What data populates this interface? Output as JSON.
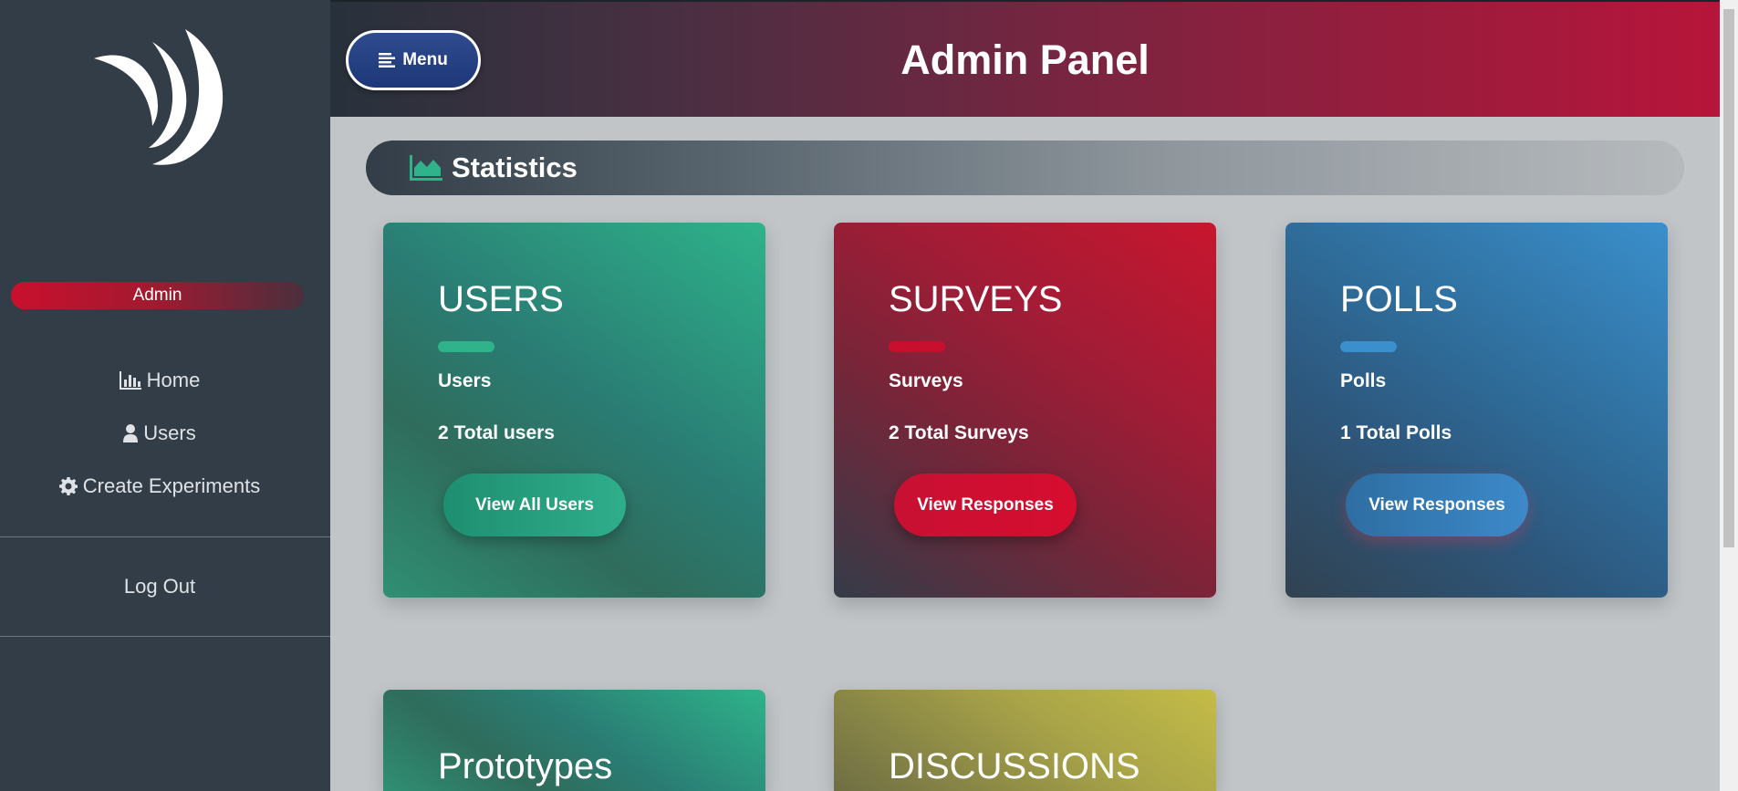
{
  "sidebar": {
    "logo_icon": "crescent-swoosh-logo",
    "role_badge": "Admin",
    "nav": [
      {
        "label": "Home",
        "icon": "bar-chart-icon"
      },
      {
        "label": "Users",
        "icon": "user-icon"
      },
      {
        "label": "Create Experiments",
        "icon": "gear-icon"
      }
    ],
    "logout_label": "Log Out"
  },
  "header": {
    "menu_label": "Menu",
    "menu_icon": "menu-lines-icon",
    "title": "Admin Panel"
  },
  "statistics": {
    "title": "Statistics",
    "icon": "area-chart-icon"
  },
  "cards": [
    {
      "title": "USERS",
      "subtitle": "Users",
      "count": "2 Total users",
      "button": "View All Users",
      "accent": "#2fb38a"
    },
    {
      "title": "SURVEYS",
      "subtitle": "Surveys",
      "count": "2 Total Surveys",
      "button": "View Responses",
      "accent": "#c8102e"
    },
    {
      "title": "POLLS",
      "subtitle": "Polls",
      "count": "1 Total Polls",
      "button": "View Responses",
      "accent": "#3a8fcc"
    },
    {
      "title": "Prototypes"
    },
    {
      "title": "DISCUSSIONS"
    }
  ]
}
